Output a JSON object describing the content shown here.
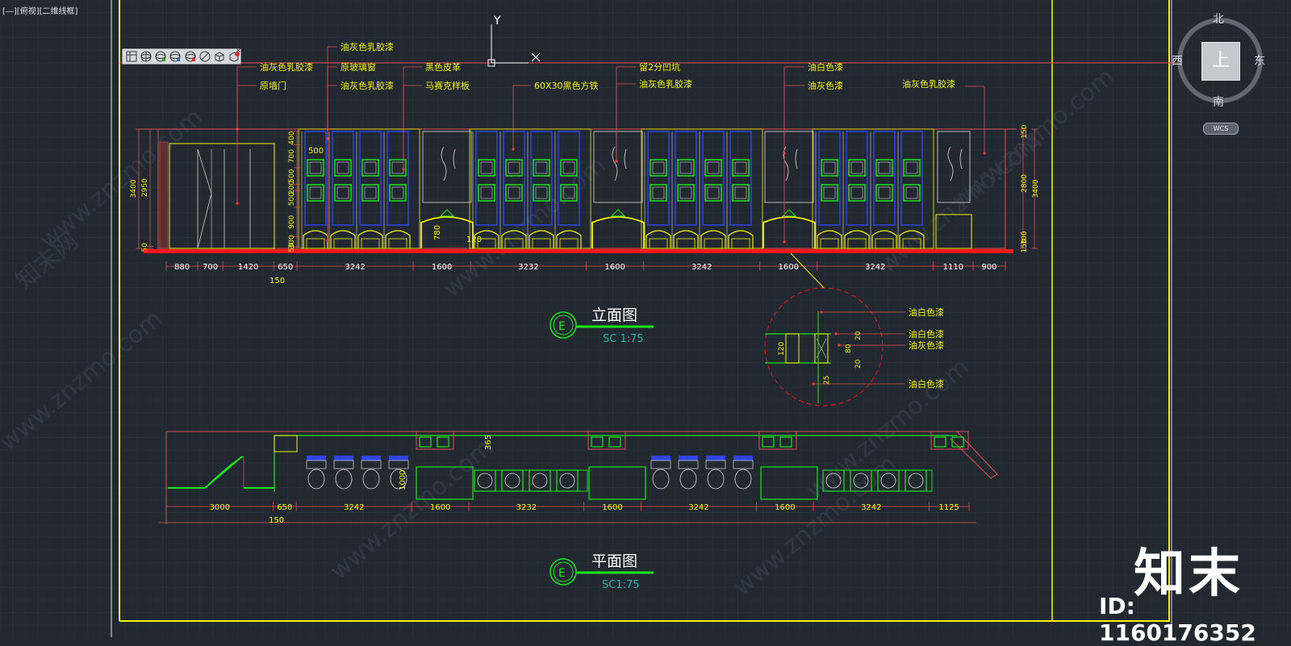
{
  "viewport_label": "[—][俯视][二维线框]",
  "toolbar": {
    "icons": [
      "layer-manager-icon",
      "sphere-icon",
      "sphere-add-icon",
      "sphere-check-icon",
      "sphere-minus-icon",
      "no-sign-icon",
      "cube-icon",
      "cube-delete-icon"
    ],
    "close_label": "×"
  },
  "viewcube": {
    "north": "北",
    "south": "南",
    "west": "西",
    "east": "东",
    "top_face": "上",
    "wcs": "WCS"
  },
  "ucs_icon": {
    "y_label": "Y"
  },
  "elevation": {
    "title": "立面图",
    "marker_letter": "E",
    "scale": "SC 1:75",
    "callouts": [
      "油灰色乳胶漆",
      "原墙门",
      "油灰色乳胶漆",
      "原玻璃窗",
      "油灰色乳胶漆",
      "黑色皮革",
      "马赛克样板",
      "60X30黑色方铁",
      "留2分凹坑",
      "油灰色乳胶漆",
      "油白色漆",
      "油灰色漆",
      "油灰色乳胶漆"
    ],
    "bottom_dims": [
      "880",
      "700",
      "1420",
      "650",
      "3242",
      "1600",
      "3232",
      "1600",
      "3242",
      "1600",
      "3242",
      "1110",
      "900"
    ],
    "sub_dim": "150",
    "left_dims": [
      "400",
      "700",
      "500",
      "200",
      "500",
      "900",
      "300",
      "50"
    ],
    "left_totals": [
      "3400",
      "2950"
    ],
    "right_dims": [
      "150",
      "2800",
      "3400",
      "300",
      "150"
    ],
    "inner_dims": [
      "500",
      "780",
      "120"
    ]
  },
  "detail": {
    "callouts": [
      "油白色漆",
      "油白色漆",
      "油灰色漆",
      "油白色漆"
    ],
    "dims": [
      "20",
      "80",
      "20",
      "120",
      "25"
    ]
  },
  "plan": {
    "title": "平面图",
    "marker_letter": "E",
    "scale": "SC1:75",
    "bottom_dims": [
      "3000",
      "650",
      "3242",
      "1600",
      "3232",
      "1600",
      "3242",
      "1600",
      "3242",
      "1125"
    ],
    "sub_dim": "150",
    "inner_dims": [
      "365",
      "1000"
    ]
  },
  "watermark": {
    "brand": "知末",
    "id": "ID: 1160176352",
    "site": "www.znzmo.com",
    "site_cn": "知末网"
  },
  "colors": {
    "background": "#212830",
    "frame_yellow": "#f4f400",
    "baseline_red": "#ff1818",
    "wall_green": "#19e619",
    "panel_blue": "#2f45e8",
    "dim_red": "#ff5a5a",
    "scale_cyan": "#26b7a6"
  }
}
